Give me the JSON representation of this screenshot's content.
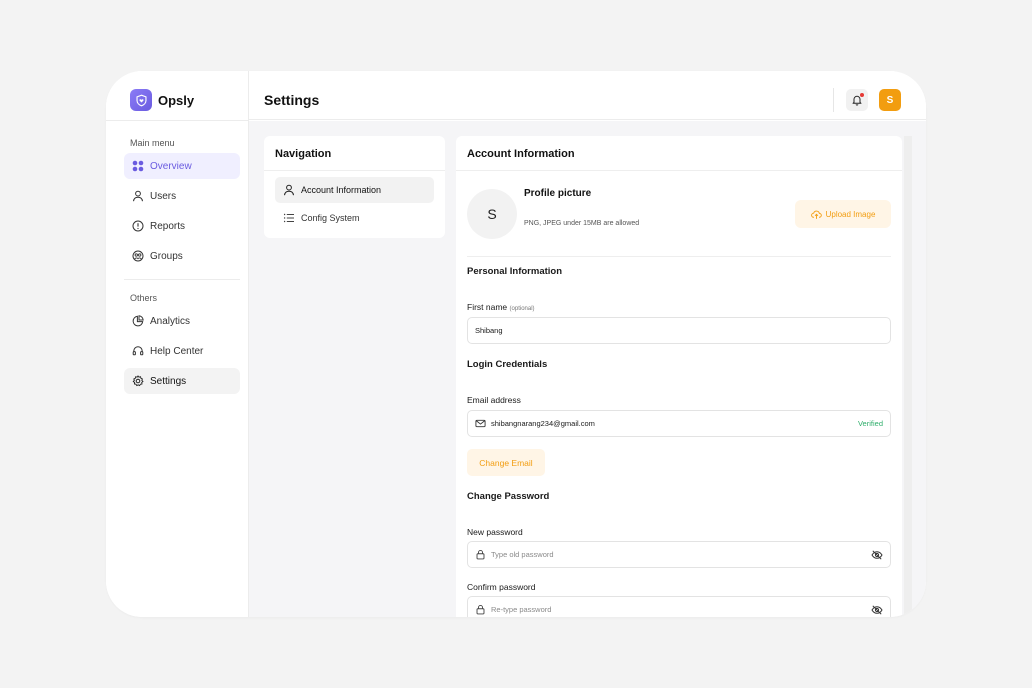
{
  "brand": {
    "name": "Opsly",
    "logo_icon": "shield-heart-icon",
    "logo_color": "#7a6af0"
  },
  "sidebar": {
    "main_label": "Main menu",
    "main_items": [
      {
        "label": "Overview",
        "icon": "grid-icon",
        "active": true
      },
      {
        "label": "Users",
        "icon": "user-icon"
      },
      {
        "label": "Reports",
        "icon": "alert-circle-icon"
      },
      {
        "label": "Groups",
        "icon": "groups-icon"
      }
    ],
    "others_label": "Others",
    "other_items": [
      {
        "label": "Analytics",
        "icon": "pie-chart-icon"
      },
      {
        "label": "Help Center",
        "icon": "headset-icon"
      },
      {
        "label": "Settings",
        "icon": "gear-icon",
        "active": true
      }
    ]
  },
  "header": {
    "title": "Settings",
    "avatar_initial": "S",
    "avatar_color": "#f29d10"
  },
  "navigation": {
    "title": "Navigation",
    "items": [
      {
        "label": "Account Information",
        "icon": "user-icon",
        "active": true
      },
      {
        "label": "Config System",
        "icon": "list-icon"
      }
    ]
  },
  "account": {
    "title": "Account Information",
    "profile": {
      "initial": "S",
      "title": "Profile picture",
      "note": "PNG, JPEG under 15MB are allowed",
      "upload_label": "Upload Image"
    },
    "personal": {
      "title": "Personal Information",
      "first_name_label": "First name",
      "first_name_optional": "(optional)",
      "first_name_value": "Shibang"
    },
    "login": {
      "title": "Login Credentials",
      "email_label": "Email address",
      "email_value": "shibangnarang234@gmail.com",
      "email_status": "Verified",
      "change_email_label": "Change Email"
    },
    "password": {
      "title": "Change Password",
      "new_label": "New password",
      "new_placeholder": "Type old password",
      "confirm_label": "Confirm password",
      "confirm_placeholder": "Re-type password"
    }
  },
  "colors": {
    "accent": "#6a5be0",
    "orange": "#f29d10",
    "verified": "#2fae6b"
  }
}
